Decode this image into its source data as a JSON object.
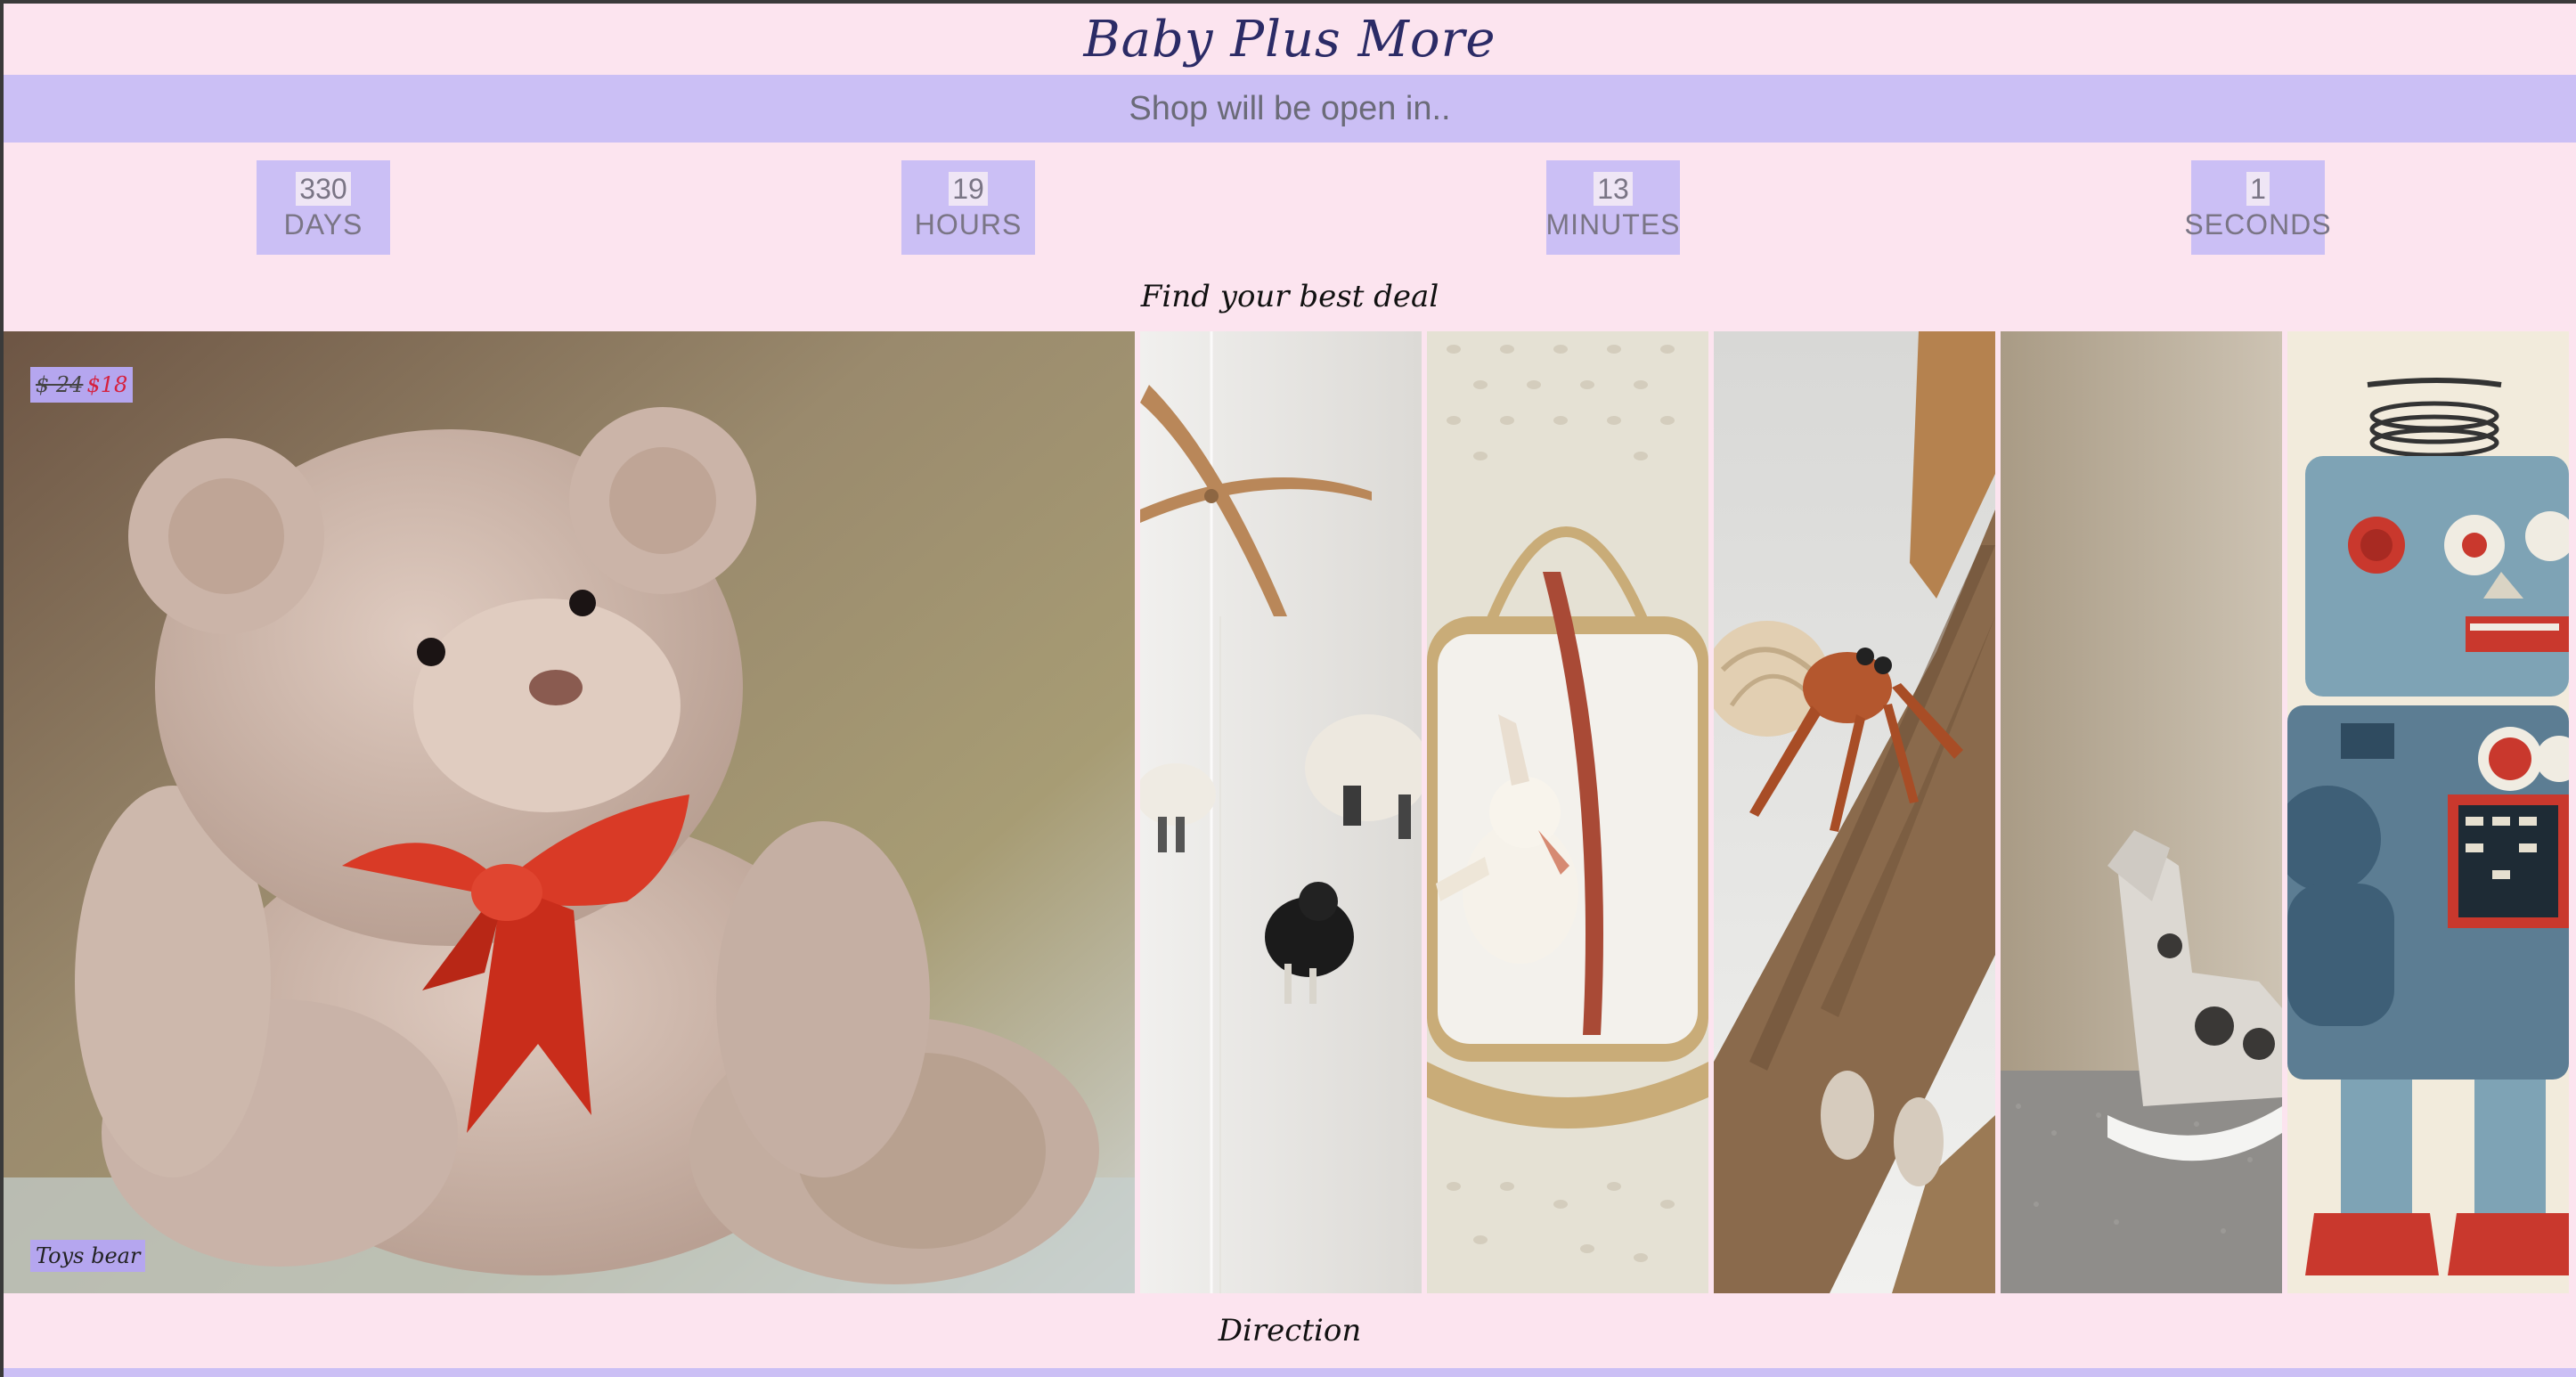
{
  "brand": {
    "name": "Baby Plus More"
  },
  "banner": {
    "text": "Shop will be open in.."
  },
  "countdown": [
    {
      "value": "330",
      "label": "DAYS"
    },
    {
      "value": "19",
      "label": "HOURS"
    },
    {
      "value": "13",
      "label": "MINUTES"
    },
    {
      "value": "1",
      "label": "SECONDS"
    }
  ],
  "deals": {
    "title": "Find your best deal",
    "featured": {
      "old_price": "$ 24",
      "new_price": "$18",
      "name": "Toys bear"
    },
    "products": [
      {
        "image": "teddy-bear-photo"
      },
      {
        "image": "sheep-mobile-photo"
      },
      {
        "image": "basket-bunny-photo"
      },
      {
        "image": "hermit-crab-toy-photo"
      },
      {
        "image": "rocking-horse-photo"
      },
      {
        "image": "tin-robot-photo"
      }
    ]
  },
  "footer": {
    "direction_label": "Direction"
  },
  "colors": {
    "page_bg": "#fce4ef",
    "accent_lavender": "#cbbff5",
    "tag_bg": "#b5a6ef",
    "brand_text": "#2b2b66",
    "sale_red": "#d5203e"
  }
}
